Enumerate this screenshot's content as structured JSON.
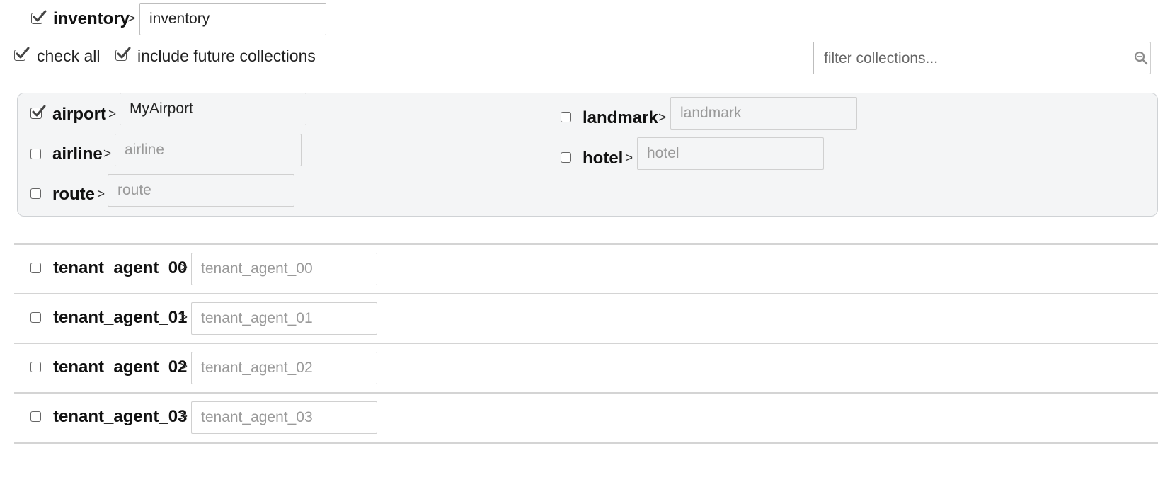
{
  "top_bucket": {
    "label": "inventory",
    "separator": ">",
    "input_value": "inventory",
    "checked": true
  },
  "options": {
    "check_all_label": "check all",
    "include_future_label": "include future collections"
  },
  "filter": {
    "placeholder": "filter collections..."
  },
  "scope_panel": {
    "left_column": [
      {
        "label": "airport",
        "value": "MyAirport",
        "placeholder": "",
        "checked": true
      },
      {
        "label": "airline",
        "value": "",
        "placeholder": "airline",
        "checked": false
      },
      {
        "label": "route",
        "value": "",
        "placeholder": "route",
        "checked": false
      }
    ],
    "right_column": [
      {
        "label": "landmark",
        "value": "",
        "placeholder": "landmark",
        "checked": false
      },
      {
        "label": "hotel",
        "value": "",
        "placeholder": "hotel",
        "checked": false
      }
    ]
  },
  "scopes": [
    {
      "label": "tenant_agent_00",
      "placeholder": "tenant_agent_00",
      "checked": false
    },
    {
      "label": "tenant_agent_01",
      "placeholder": "tenant_agent_01",
      "checked": false
    },
    {
      "label": "tenant_agent_02",
      "placeholder": "tenant_agent_02",
      "checked": false
    },
    {
      "label": "tenant_agent_03",
      "placeholder": "tenant_agent_03",
      "checked": false
    }
  ],
  "separator": ">",
  "icons": {
    "checkbox_checked": "checkbox-checked-icon",
    "checkbox_empty": "checkbox-empty-icon",
    "search": "search-icon"
  },
  "colors": {
    "panel_bg": "#f4f5f6",
    "border": "#d4d4d4",
    "text": "#111111",
    "placeholder": "#9a9a9a"
  }
}
